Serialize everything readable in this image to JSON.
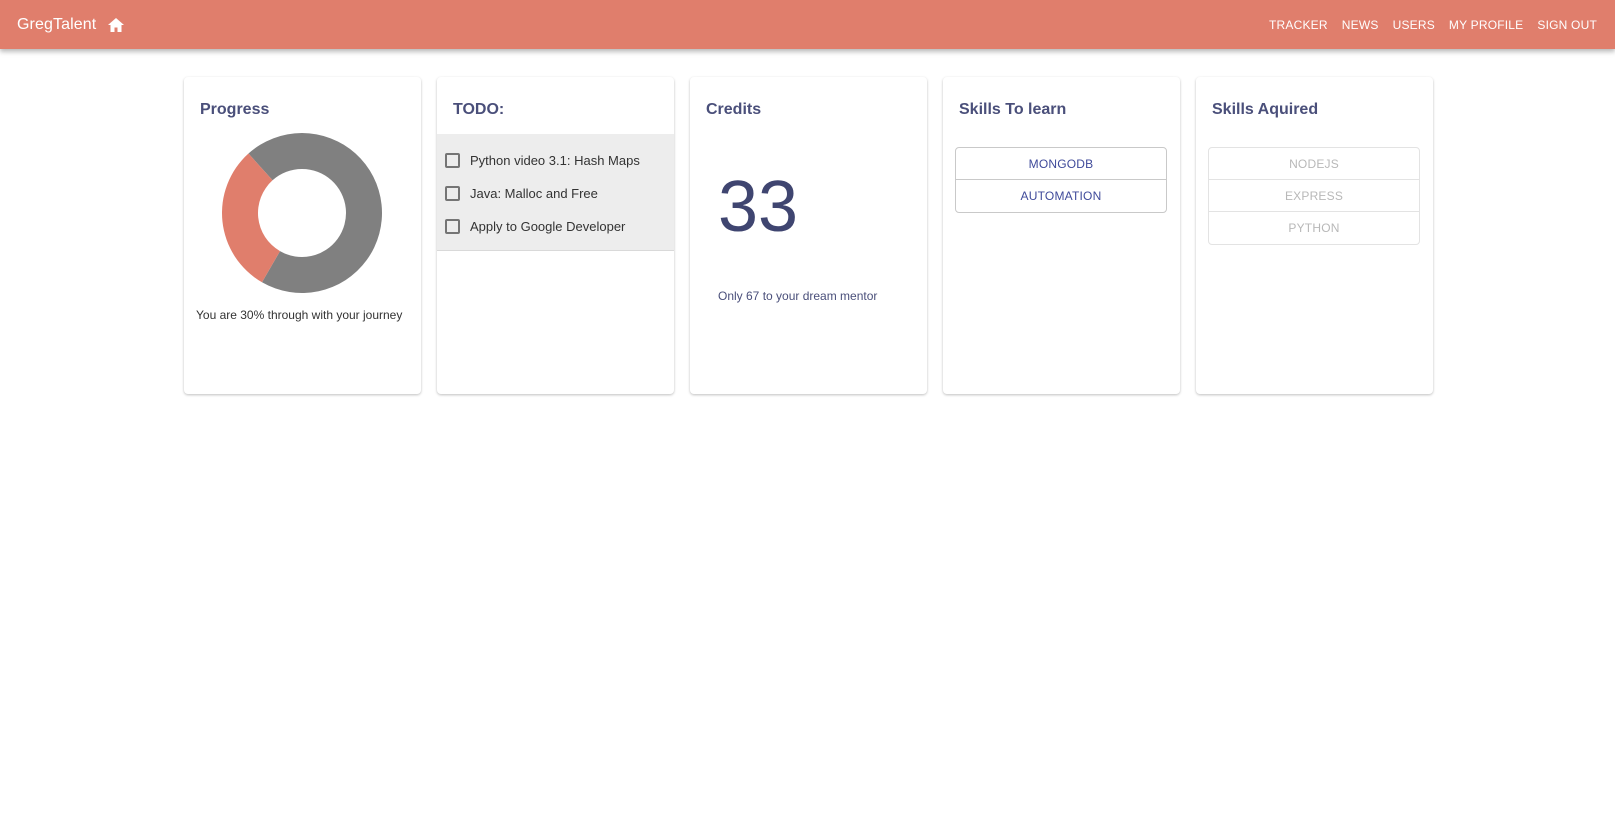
{
  "appbar": {
    "brand": "GregTalent",
    "home_icon": "home-icon",
    "bg_color": "#e07e6c",
    "nav": [
      "TRACKER",
      "NEWS",
      "USERS",
      "MY PROFILE",
      "SIGN OUT"
    ]
  },
  "progress": {
    "title": "Progress",
    "percent": 30,
    "completed_color": "#e07e6c",
    "remaining_color": "#808080",
    "text": "You are 30% through with your journey"
  },
  "todo": {
    "title": "TODO:",
    "items": [
      "Python video 3.1: Hash Maps",
      "Java: Malloc and Free",
      "Apply to Google Developer"
    ]
  },
  "credits": {
    "title": "Credits",
    "value": "33",
    "subtext": "Only 67 to your dream mentor"
  },
  "skills_to_learn": {
    "title": "Skills To learn",
    "items": [
      "MONGODB",
      "AUTOMATION"
    ]
  },
  "skills_acquired": {
    "title": "Skills Aquired",
    "items": [
      "NODEJS",
      "EXPRESS",
      "PYTHON"
    ]
  }
}
